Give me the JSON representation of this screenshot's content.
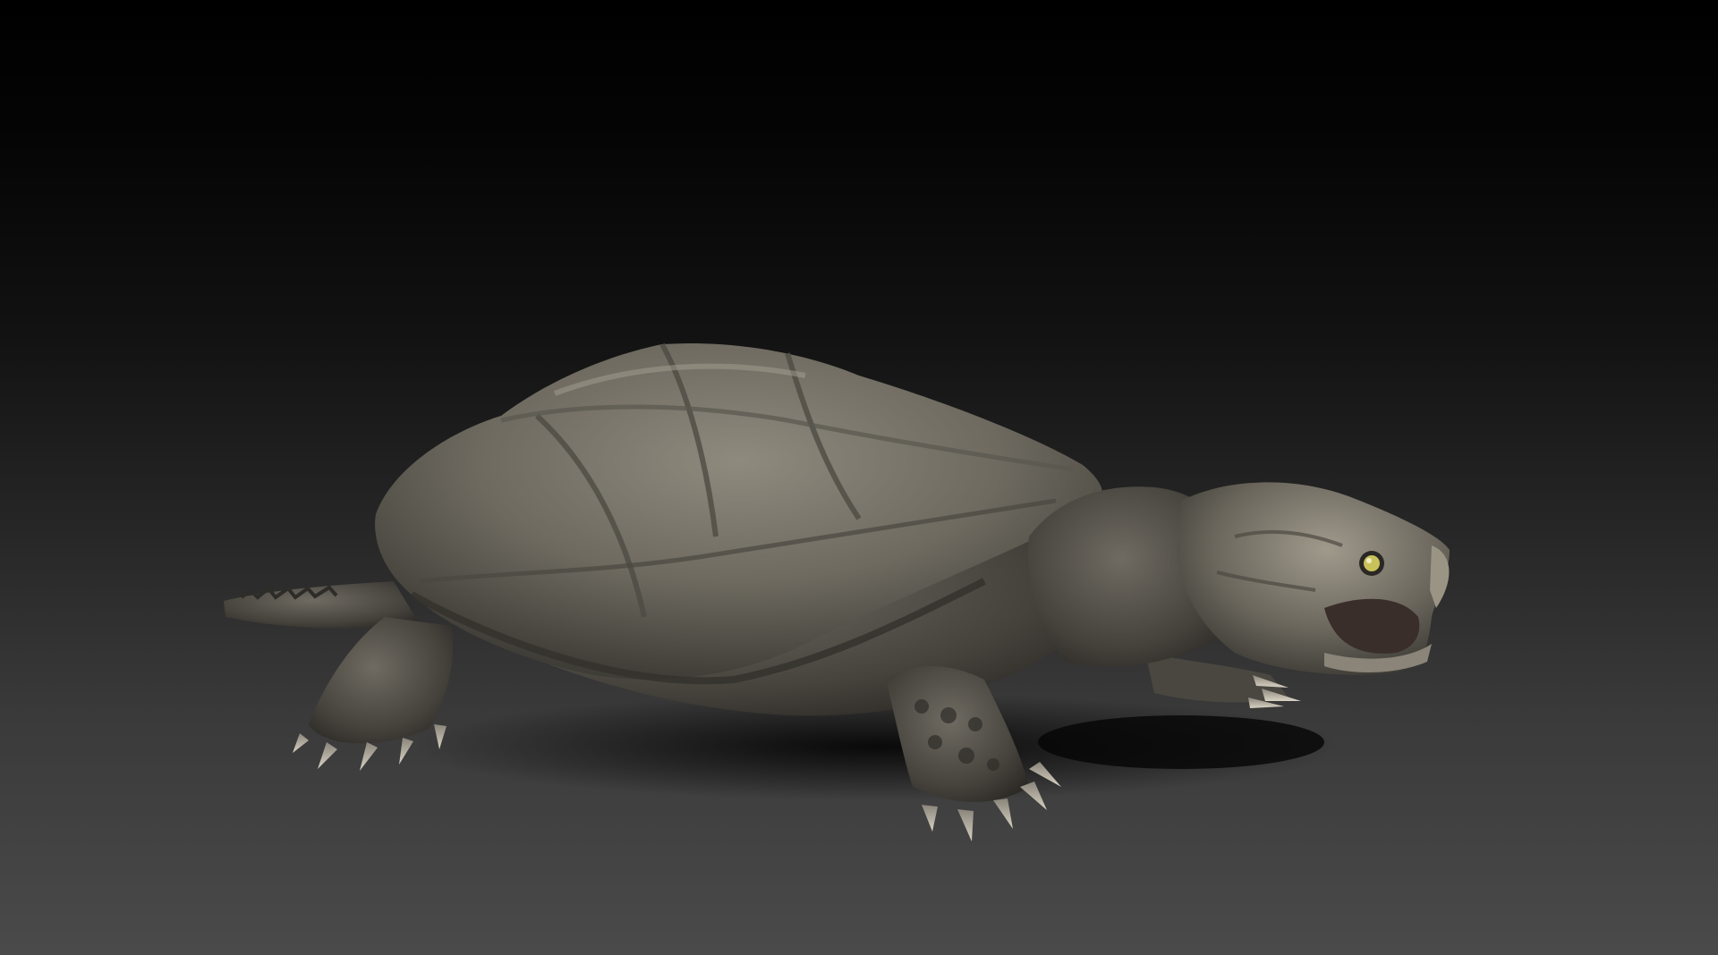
{
  "scene": {
    "subject_icon": "turtle-icon",
    "colors": {
      "background_top": "#000000",
      "background_bottom": "#4a4a4a",
      "shell_light": "#8a8578",
      "shell_mid": "#6e6a60",
      "shell_dark": "#3f3d37",
      "skin_light": "#77736a",
      "skin_dark": "#35332e",
      "eye": "#c9c25a",
      "mouth": "#3a2e2b",
      "shadow": "#0e0e0e"
    }
  }
}
